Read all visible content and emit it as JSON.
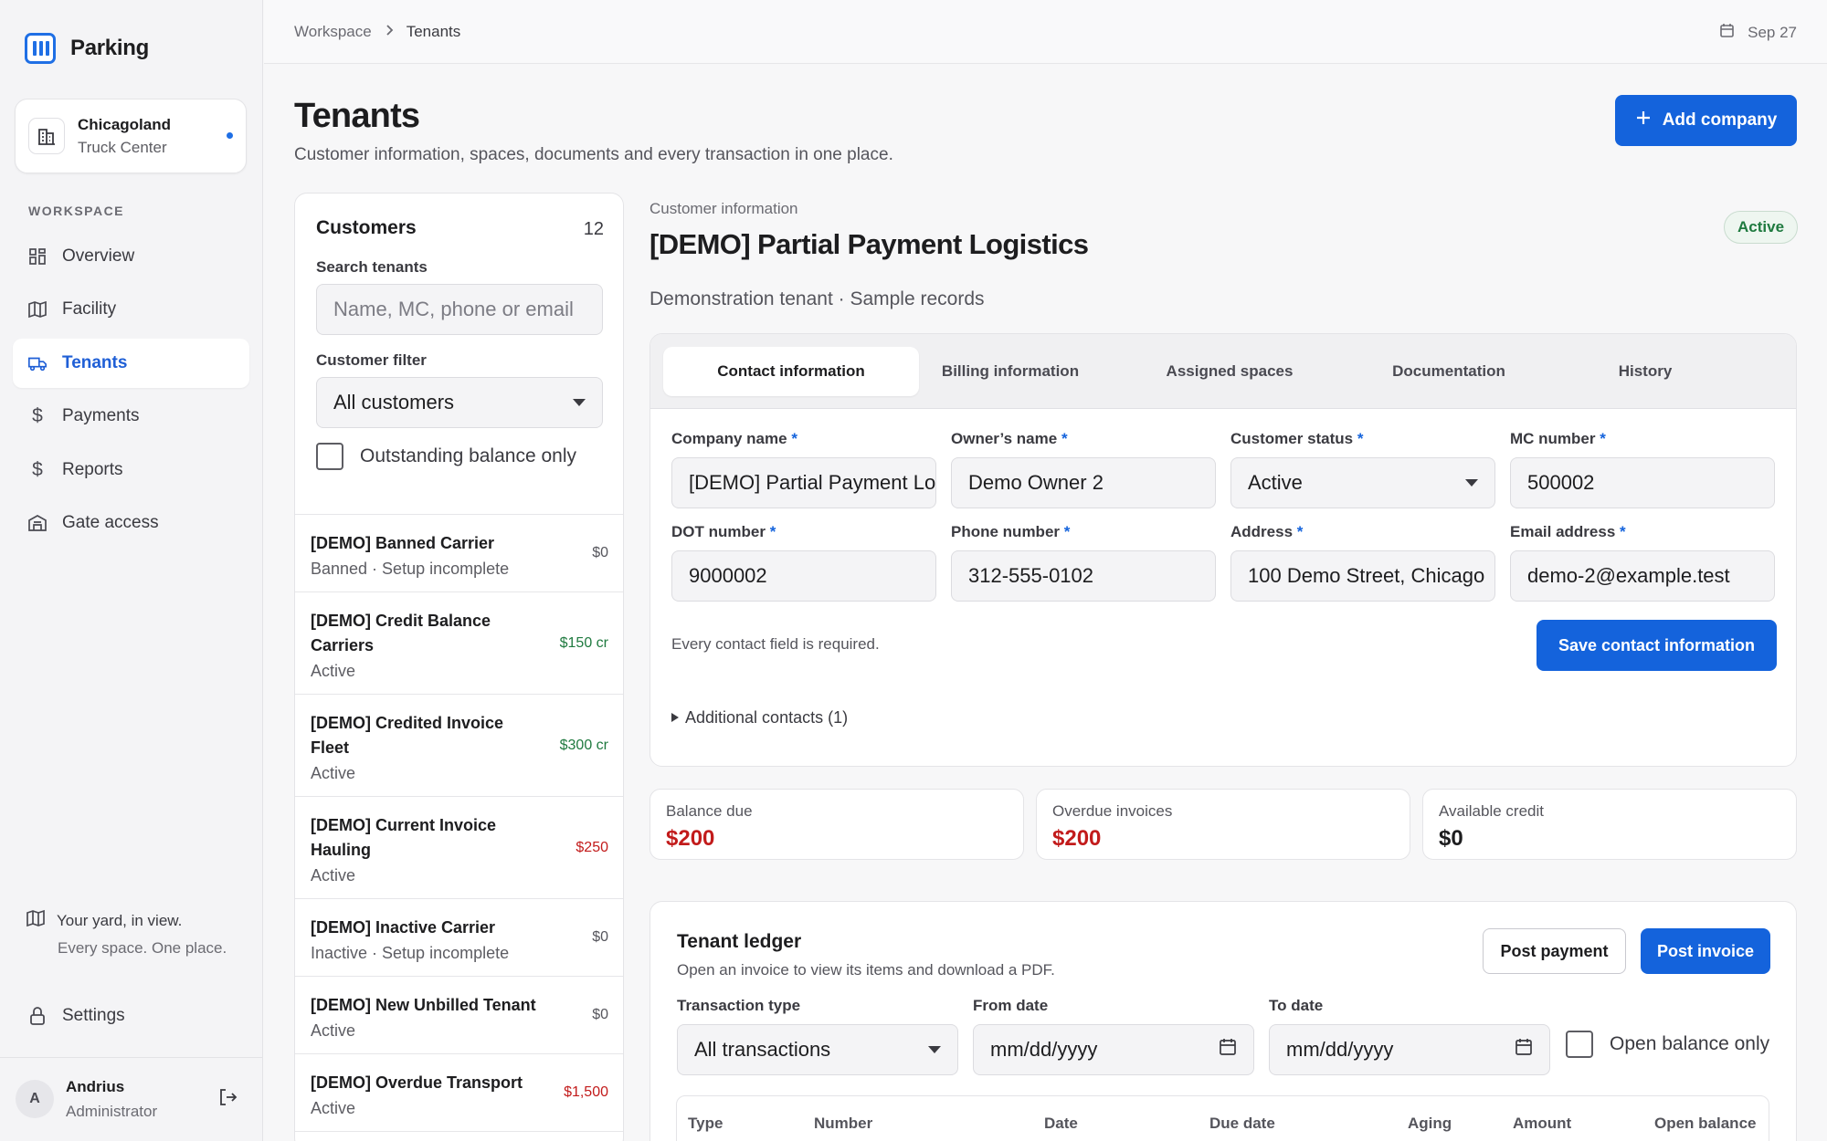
{
  "app": {
    "name": "Parking"
  },
  "facility": {
    "name": "Chicagoland",
    "sub": "Truck Center"
  },
  "nav": {
    "heading": "WORKSPACE",
    "items": [
      {
        "label": "Overview",
        "icon": "grid-icon"
      },
      {
        "label": "Facility",
        "icon": "map-icon"
      },
      {
        "label": "Tenants",
        "icon": "truck-icon",
        "active": true
      },
      {
        "label": "Payments",
        "icon": "dollar-icon"
      },
      {
        "label": "Reports",
        "icon": "dollar-icon"
      },
      {
        "label": "Gate access",
        "icon": "building-icon"
      }
    ]
  },
  "promo": {
    "title": "Your yard, in view.",
    "subtitle": "Every space. One place."
  },
  "settings": {
    "label": "Settings"
  },
  "user": {
    "initial": "A",
    "name": "Andrius",
    "role": "Administrator"
  },
  "breadcrumb": {
    "root": "Workspace",
    "current": "Tenants"
  },
  "date": "Sep 27",
  "page": {
    "title": "Tenants",
    "subtitle": "Customer information, spaces, documents and every transaction in one place.",
    "add_button": "Add company"
  },
  "customers": {
    "title": "Customers",
    "count": "12",
    "search_label": "Search tenants",
    "search_placeholder": "Name, MC, phone or email",
    "filter_label": "Customer filter",
    "filter_value": "All customers",
    "outstanding_label": "Outstanding balance only",
    "list": [
      {
        "name": "[DEMO] Banned Carrier",
        "status": "Banned · Setup incomplete",
        "amount": "$0",
        "kind": "zero"
      },
      {
        "name": "[DEMO] Credit Balance Carriers",
        "status": "Active",
        "amount": "$150 cr",
        "kind": "cr"
      },
      {
        "name": "[DEMO] Credited Invoice Fleet",
        "status": "Active",
        "amount": "$300 cr",
        "kind": "cr"
      },
      {
        "name": "[DEMO] Current Invoice Hauling",
        "status": "Active",
        "amount": "$250",
        "kind": "due"
      },
      {
        "name": "[DEMO] Inactive Carrier",
        "status": "Inactive · Setup incomplete",
        "amount": "$0",
        "kind": "zero"
      },
      {
        "name": "[DEMO] New Unbilled Tenant",
        "status": "Active",
        "amount": "$0",
        "kind": "zero"
      },
      {
        "name": "[DEMO] Overdue Transport",
        "status": "Active",
        "amount": "$1,500",
        "kind": "due"
      }
    ]
  },
  "detail": {
    "label": "Customer information",
    "name": "[DEMO] Partial Payment Logistics",
    "subtitle": "Demonstration tenant · Sample records",
    "status": "Active"
  },
  "tabs": [
    "Contact information",
    "Billing information",
    "Assigned spaces",
    "Documentation",
    "History"
  ],
  "contact": {
    "fields": [
      {
        "label": "Company name",
        "value": "[DEMO] Partial Payment Logistics",
        "type": "text"
      },
      {
        "label": "Owner’s name",
        "value": "Demo Owner 2",
        "type": "text"
      },
      {
        "label": "Customer status",
        "value": "Active",
        "type": "select"
      },
      {
        "label": "MC number",
        "value": "500002",
        "type": "text"
      },
      {
        "label": "DOT number",
        "value": "9000002",
        "type": "text"
      },
      {
        "label": "Phone number",
        "value": "312-555-0102",
        "type": "text"
      },
      {
        "label": "Address",
        "value": "100 Demo Street, Chicago",
        "type": "text"
      },
      {
        "label": "Email address",
        "value": "demo-2@example.test",
        "type": "text"
      }
    ],
    "required_marker": "*",
    "note": "Every contact field is required.",
    "save_button": "Save contact information",
    "additional": "Additional contacts (1)"
  },
  "stats": [
    {
      "label": "Balance due",
      "value": "$200",
      "tone": "red"
    },
    {
      "label": "Overdue invoices",
      "value": "$200",
      "tone": "red"
    },
    {
      "label": "Available credit",
      "value": "$0",
      "tone": "plain"
    }
  ],
  "ledger": {
    "title": "Tenant ledger",
    "subtitle": "Open an invoice to view its items and download a PDF.",
    "post_payment": "Post payment",
    "post_invoice": "Post invoice",
    "type_label": "Transaction type",
    "type_value": "All transactions",
    "from_label": "From date",
    "from_placeholder": "mm/dd/yyyy",
    "to_label": "To date",
    "to_placeholder": "mm/dd/yyyy",
    "open_only": "Open balance only",
    "columns": [
      "Type",
      "Number",
      "Date",
      "Due date",
      "Aging",
      "Amount",
      "Open balance"
    ]
  },
  "colors": {
    "accent": "#1463dc",
    "credit": "#1f7a3f",
    "due": "#c21b1b"
  }
}
